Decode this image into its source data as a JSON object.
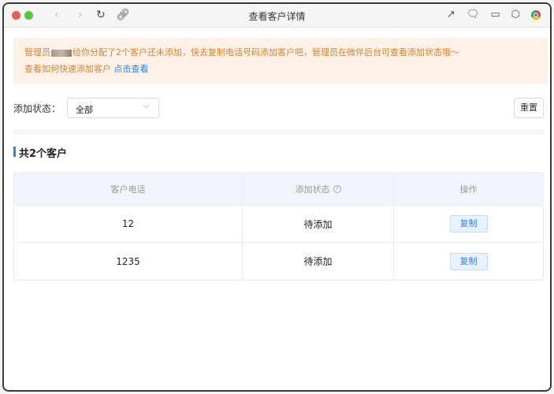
{
  "window": {
    "title": "查看客户详情",
    "nav_icons": [
      "back-icon",
      "forward-icon",
      "reload-icon",
      "link-icon"
    ],
    "toolbar_icons": [
      "share-icon",
      "wechat-icon",
      "screencast-icon",
      "cube-icon",
      "chrome-icon"
    ]
  },
  "notice": {
    "prefix": "管理员",
    "line1_rest": "给你分配了2个客户还未添加，快去复制电话号码添加客户吧，管理员在微伴后台可查看添加状态哦～",
    "line2_text": "查看如何快速添加客户",
    "line2_link": "点击查看"
  },
  "filter": {
    "label": "添加状态：",
    "selected": "全部",
    "reset_label": "重置"
  },
  "section": {
    "title": "共2个客户"
  },
  "table": {
    "headers": [
      "客户电话",
      "添加状态",
      "操作"
    ],
    "rows": [
      {
        "phone": "12",
        "status": "待添加",
        "action": "复制"
      },
      {
        "phone": "1235",
        "status": "待添加",
        "action": "复制"
      }
    ]
  },
  "colors": {
    "accent": "#2d84f0",
    "notice_bg": "#fdf1e8",
    "notice_text": "#d9822b",
    "table_header_bg": "#f0f6fb"
  }
}
